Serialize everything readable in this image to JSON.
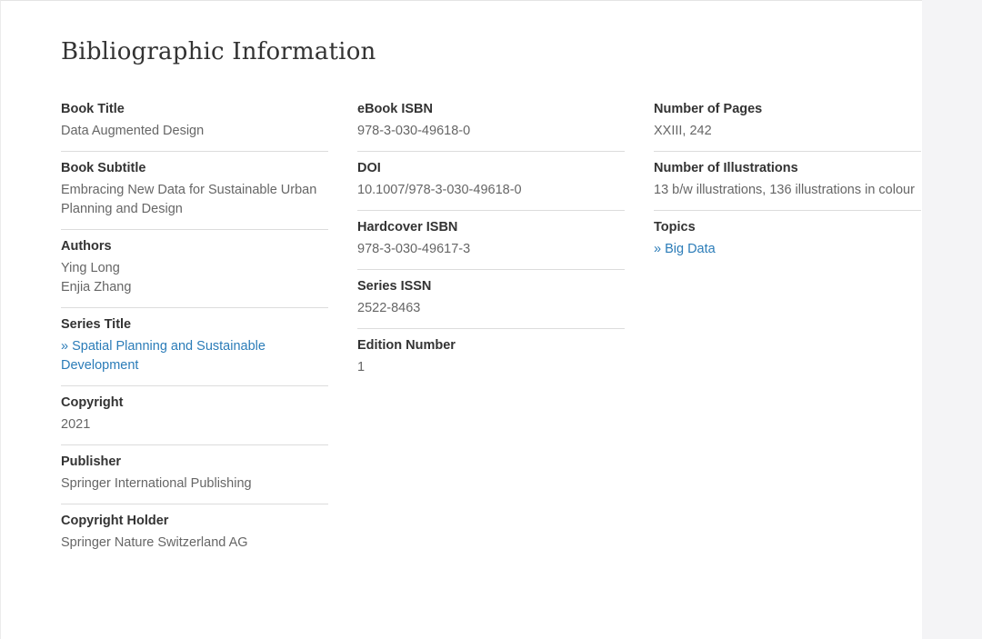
{
  "page": {
    "heading": "Bibliographic Information"
  },
  "left_column": {
    "book_title": {
      "label": "Book Title",
      "value": "Data Augmented Design"
    },
    "book_subtitle": {
      "label": "Book Subtitle",
      "value": "Embracing New Data for Sustainable Urban Planning and Design"
    },
    "authors": {
      "label": "Authors",
      "values": [
        "Ying Long",
        "Enjia Zhang"
      ]
    },
    "series_title": {
      "label": "Series Title",
      "link": "» Spatial Planning and Sustainable Development"
    },
    "copyright": {
      "label": "Copyright",
      "value": "2021"
    },
    "publisher": {
      "label": "Publisher",
      "value": "Springer International Publishing"
    },
    "copyright_holder": {
      "label": "Copyright Holder",
      "value": "Springer Nature Switzerland AG"
    }
  },
  "middle_column": {
    "ebook_isbn": {
      "label": "eBook ISBN",
      "value": "978-3-030-49618-0"
    },
    "doi": {
      "label": "DOI",
      "value": "10.1007/978-3-030-49618-0"
    },
    "hardcover_isbn": {
      "label": "Hardcover ISBN",
      "value": "978-3-030-49617-3"
    },
    "series_issn": {
      "label": "Series ISSN",
      "value": "2522-8463"
    },
    "edition_number": {
      "label": "Edition Number",
      "value": "1"
    }
  },
  "right_column": {
    "number_of_pages": {
      "label": "Number of Pages",
      "value": "XXIII, 242"
    },
    "number_of_illustrations": {
      "label": "Number of Illustrations",
      "value": "13 b/w illustrations, 136 illustrations in colour"
    },
    "topics": {
      "label": "Topics",
      "link": "» Big Data"
    }
  },
  "colors": {
    "link": "#2b7cb8",
    "label_text": "#333333",
    "value_text": "#666666",
    "divider": "#dcdcdc"
  }
}
